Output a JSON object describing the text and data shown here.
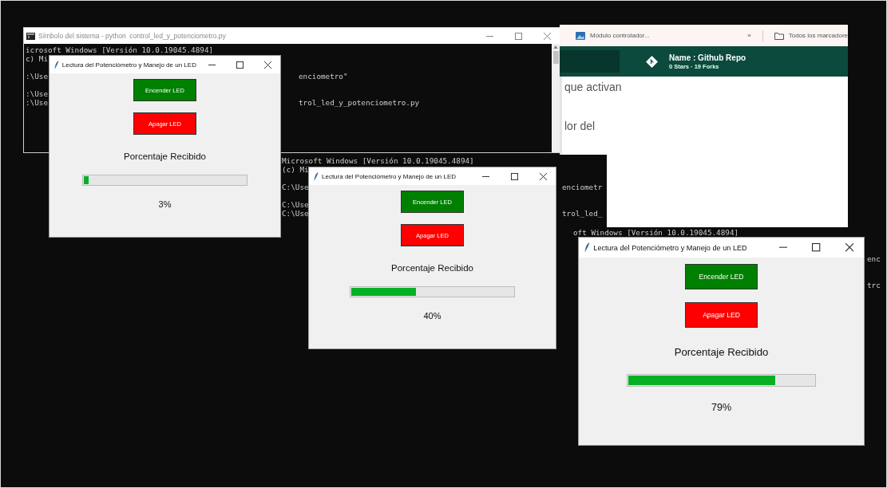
{
  "consoles": [
    {
      "title": "Símbolo del sistema - python  control_led_y_potenciometro.py",
      "rows": [
        {
          "kind": "line",
          "text": "icrosoft Windows [Versión 10.0.19045.4894]"
        },
        {
          "kind": "line",
          "text": "c) Mi"
        },
        {
          "kind": "blank"
        },
        {
          "kind": "line",
          "text": ":\\Use",
          "tail": "enciometro\""
        },
        {
          "kind": "blank"
        },
        {
          "kind": "line",
          "text": ":\\Use"
        },
        {
          "kind": "line",
          "text": ":\\Use",
          "tail": "trol_led_y_potenciometro.py"
        }
      ]
    },
    {
      "rows": [
        {
          "kind": "line",
          "text": "Microsoft Windows [Versión 10.0.19045.4894]"
        },
        {
          "kind": "line",
          "text": "(c) Mi"
        },
        {
          "kind": "blank"
        },
        {
          "kind": "line",
          "text": "C:\\Use",
          "tail": "enciometr"
        },
        {
          "kind": "blank"
        },
        {
          "kind": "line",
          "text": "C:\\Use"
        },
        {
          "kind": "line",
          "text": "C:\\Use",
          "tail": "trol_led_"
        }
      ]
    },
    {
      "rows": [
        {
          "kind": "line",
          "text": "oft Windows [Versión 10.0.19045.4894]"
        },
        {
          "kind": "blank"
        },
        {
          "kind": "blank"
        },
        {
          "kind": "line",
          "tail": "enc"
        },
        {
          "kind": "blank"
        },
        {
          "kind": "blank"
        },
        {
          "kind": "line",
          "tail": "trc"
        }
      ]
    }
  ],
  "browser": {
    "bookmark": "Módulo controlador...",
    "overflow": "»",
    "folder": "Todos los marcadore",
    "repo": {
      "name": "Name : Github Repo",
      "stats": "0 Stars · 19 Forks"
    },
    "body_lines": [
      "que activan",
      "lor del"
    ]
  },
  "apps": [
    {
      "title": "Lectura del Potenciómetro y Manejo de un LED",
      "buttons": [
        {
          "label": "Encender LED",
          "kind": "on"
        },
        {
          "label": "Apagar LED",
          "kind": "off"
        }
      ],
      "label": "Porcentaje Recibido",
      "level": 0.03,
      "reading": "3%"
    },
    {
      "title": "Lectura del Potenciómetro y Manejo de un LED",
      "buttons": [
        {
          "label": "Encender LED",
          "kind": "on"
        },
        {
          "label": "Apagar LED",
          "kind": "off"
        }
      ],
      "label": "Porcentaje Recibido",
      "level": 0.4,
      "reading": "40%"
    },
    {
      "title": "Lectura del Potenciómetro y Manejo de un LED",
      "buttons": [
        {
          "label": "Encender LED",
          "kind": "on"
        },
        {
          "label": "Apagar LED",
          "kind": "off"
        }
      ],
      "label": "Porcentaje Recibido",
      "level": 0.79,
      "reading": "79%"
    }
  ]
}
